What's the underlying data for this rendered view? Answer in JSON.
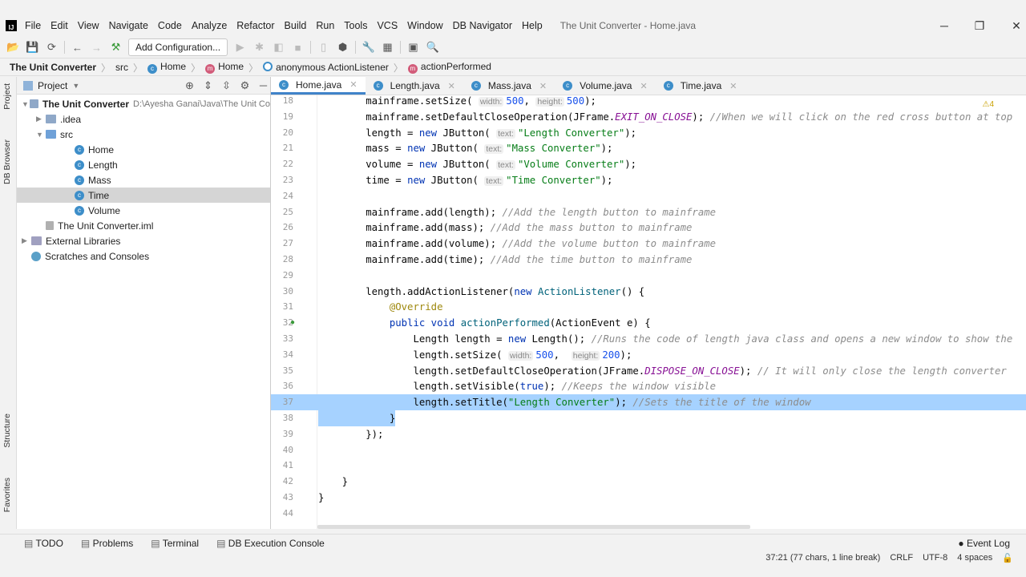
{
  "window": {
    "title": "The Unit Converter - Home.java",
    "logo": "IJ"
  },
  "menu": [
    "File",
    "Edit",
    "View",
    "Navigate",
    "Code",
    "Analyze",
    "Refactor",
    "Build",
    "Run",
    "Tools",
    "VCS",
    "Window",
    "DB Navigator",
    "Help"
  ],
  "toolbar": {
    "add_config": "Add Configuration..."
  },
  "breadcrumb": [
    {
      "icon": "",
      "label": "The Unit Converter",
      "bold": true
    },
    {
      "icon": "",
      "label": "src"
    },
    {
      "icon": "c",
      "label": "Home"
    },
    {
      "icon": "m",
      "label": "Home"
    },
    {
      "icon": "a",
      "label": "anonymous ActionListener"
    },
    {
      "icon": "m",
      "label": "actionPerformed"
    }
  ],
  "sidebar_strip": {
    "project": "Project",
    "db_browser": "DB Browser",
    "structure": "Structure",
    "favorites": "Favorites"
  },
  "project": {
    "title": "Project",
    "tree": [
      {
        "label": "The Unit Converter",
        "extra": "D:\\Ayesha Ganai\\Java\\The Unit Co",
        "depth": 0,
        "arrow": "▼",
        "type": "folder"
      },
      {
        "label": ".idea",
        "depth": 1,
        "arrow": "▶",
        "type": "folder"
      },
      {
        "label": "src",
        "depth": 1,
        "arrow": "▼",
        "type": "folder"
      },
      {
        "label": "Home",
        "depth": 2,
        "type": "class"
      },
      {
        "label": "Length",
        "depth": 2,
        "type": "class"
      },
      {
        "label": "Mass",
        "depth": 2,
        "type": "class"
      },
      {
        "label": "Time",
        "depth": 2,
        "type": "class",
        "selected": true
      },
      {
        "label": "Volume",
        "depth": 2,
        "type": "class"
      },
      {
        "label": "The Unit Converter.iml",
        "depth": 1,
        "type": "file"
      },
      {
        "label": "External Libraries",
        "depth": 0,
        "arrow": "▶",
        "type": "lib"
      },
      {
        "label": "Scratches and Consoles",
        "depth": 0,
        "type": "scratch"
      }
    ]
  },
  "tabs": [
    {
      "label": "Home.java",
      "active": true
    },
    {
      "label": "Length.java"
    },
    {
      "label": "Mass.java"
    },
    {
      "label": "Volume.java"
    },
    {
      "label": "Time.java"
    }
  ],
  "editor": {
    "warnings": "4",
    "lines": [
      {
        "n": "18",
        "t": [
          [
            "p",
            "        mainframe.setSize( "
          ],
          [
            "h",
            "width:"
          ],
          [
            "n",
            "500"
          ],
          [
            "p",
            ", "
          ],
          [
            "h",
            "height:"
          ],
          [
            "n",
            "500"
          ],
          [
            "p",
            ");"
          ]
        ]
      },
      {
        "n": "19",
        "t": [
          [
            "p",
            "        mainframe.setDefaultCloseOperation(JFrame."
          ],
          [
            "f",
            "EXIT_ON_CLOSE"
          ],
          [
            "p",
            "); "
          ],
          [
            "c",
            "//When we will click on the red cross button at top"
          ]
        ]
      },
      {
        "n": "20",
        "t": [
          [
            "p",
            "        length = "
          ],
          [
            "k",
            "new"
          ],
          [
            "p",
            " JButton( "
          ],
          [
            "h",
            "text:"
          ],
          [
            "s",
            "\"Length Converter\""
          ],
          [
            "p",
            ");"
          ]
        ]
      },
      {
        "n": "21",
        "t": [
          [
            "p",
            "        mass = "
          ],
          [
            "k",
            "new"
          ],
          [
            "p",
            " JButton( "
          ],
          [
            "h",
            "text:"
          ],
          [
            "s",
            "\"Mass Converter\""
          ],
          [
            "p",
            ");"
          ]
        ]
      },
      {
        "n": "22",
        "t": [
          [
            "p",
            "        volume = "
          ],
          [
            "k",
            "new"
          ],
          [
            "p",
            " JButton( "
          ],
          [
            "h",
            "text:"
          ],
          [
            "s",
            "\"Volume Converter\""
          ],
          [
            "p",
            ");"
          ]
        ]
      },
      {
        "n": "23",
        "t": [
          [
            "p",
            "        time = "
          ],
          [
            "k",
            "new"
          ],
          [
            "p",
            " JButton( "
          ],
          [
            "h",
            "text:"
          ],
          [
            "s",
            "\"Time Converter\""
          ],
          [
            "p",
            ");"
          ]
        ]
      },
      {
        "n": "24",
        "t": []
      },
      {
        "n": "25",
        "t": [
          [
            "p",
            "        mainframe.add(length); "
          ],
          [
            "c",
            "//Add the length button to mainframe"
          ]
        ]
      },
      {
        "n": "26",
        "t": [
          [
            "p",
            "        mainframe.add(mass); "
          ],
          [
            "c",
            "//Add the mass button to mainframe"
          ]
        ]
      },
      {
        "n": "27",
        "t": [
          [
            "p",
            "        mainframe.add(volume); "
          ],
          [
            "c",
            "//Add the volume button to mainframe"
          ]
        ]
      },
      {
        "n": "28",
        "t": [
          [
            "p",
            "        mainframe.add(time); "
          ],
          [
            "c",
            "//Add the time button to mainframe"
          ]
        ]
      },
      {
        "n": "29",
        "t": []
      },
      {
        "n": "30",
        "t": [
          [
            "p",
            "        length.addActionListener("
          ],
          [
            "k",
            "new"
          ],
          [
            "p",
            " "
          ],
          [
            "m",
            "ActionListener"
          ],
          [
            "p",
            "() {"
          ]
        ]
      },
      {
        "n": "31",
        "t": [
          [
            "a",
            "            @Override"
          ]
        ]
      },
      {
        "n": "32",
        "t": [
          [
            "k",
            "            public void "
          ],
          [
            "m",
            "actionPerformed"
          ],
          [
            "p",
            "(ActionEvent e) {"
          ]
        ]
      },
      {
        "n": "33",
        "t": [
          [
            "p",
            "                Length length = "
          ],
          [
            "k",
            "new"
          ],
          [
            "p",
            " Length(); "
          ],
          [
            "c",
            "//Runs the code of length java class and opens a new window to show the"
          ]
        ]
      },
      {
        "n": "34",
        "t": [
          [
            "p",
            "                length.setSize( "
          ],
          [
            "h",
            "width:"
          ],
          [
            "n",
            "500"
          ],
          [
            "p",
            ",  "
          ],
          [
            "h",
            "height:"
          ],
          [
            "n",
            "200"
          ],
          [
            "p",
            ");"
          ]
        ]
      },
      {
        "n": "35",
        "t": [
          [
            "p",
            "                length.setDefaultCloseOperation(JFrame."
          ],
          [
            "f",
            "DISPOSE_ON_CLOSE"
          ],
          [
            "p",
            "); "
          ],
          [
            "c",
            "// It will only close the length converter"
          ]
        ]
      },
      {
        "n": "36",
        "t": [
          [
            "p",
            "                length.setVisible("
          ],
          [
            "k",
            "true"
          ],
          [
            "p",
            "); "
          ],
          [
            "c",
            "//Keeps the window visible"
          ]
        ]
      },
      {
        "n": "37",
        "t": [
          [
            "p",
            "                length.setTitle("
          ],
          [
            "s",
            "\"Length Converter\""
          ],
          [
            "p",
            "); "
          ],
          [
            "c",
            "//Sets the title of the window"
          ]
        ],
        "hl": true
      },
      {
        "n": "38",
        "t": [
          [
            "p",
            "            }"
          ]
        ],
        "hl": "partial"
      },
      {
        "n": "39",
        "t": [
          [
            "p",
            "        });"
          ]
        ]
      },
      {
        "n": "40",
        "t": []
      },
      {
        "n": "41",
        "t": []
      },
      {
        "n": "42",
        "t": [
          [
            "p",
            "    }"
          ]
        ]
      },
      {
        "n": "43",
        "t": [
          [
            "p",
            "}"
          ]
        ]
      },
      {
        "n": "44",
        "t": []
      }
    ]
  },
  "bottom_tools": [
    "TODO",
    "Problems",
    "Terminal",
    "DB Execution Console"
  ],
  "status": {
    "position": "37:21 (77 chars, 1 line break)",
    "line_sep": "CRLF",
    "encoding": "UTF-8",
    "indent": "4 spaces",
    "event_log": "Event Log"
  }
}
